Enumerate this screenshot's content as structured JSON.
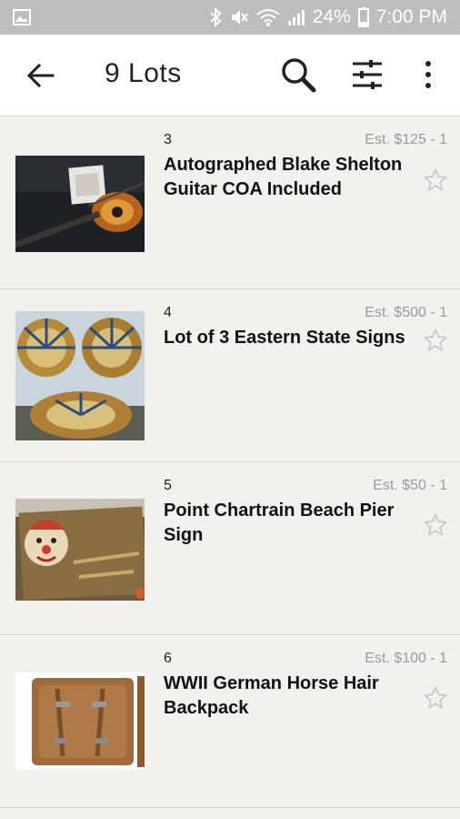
{
  "status_bar": {
    "battery_percent": "24%",
    "time": "7:00 PM",
    "icons": [
      "image-icon",
      "bluetooth-icon",
      "mute-icon",
      "wifi-icon",
      "signal-icon",
      "battery-icon"
    ]
  },
  "app_bar": {
    "title": "9 Lots",
    "icons": [
      "back-arrow-icon",
      "search-icon",
      "filter-icon",
      "more-vert-icon"
    ]
  },
  "lots": [
    {
      "number": "3",
      "estimate": "Est. $125 - 1",
      "title": "Autographed Blake Shelton Guitar COA Included",
      "favorite": false
    },
    {
      "number": "4",
      "estimate": "Est. $500 - 1",
      "title": "Lot of 3 Eastern State Signs",
      "favorite": false
    },
    {
      "number": "5",
      "estimate": "Est. $50 - 1",
      "title": "Point Chartrain Beach Pier Sign",
      "favorite": false
    },
    {
      "number": "6",
      "estimate": "Est. $100 - 1",
      "title": "WWII German Horse Hair Backpack",
      "favorite": false
    }
  ],
  "colors": {
    "status_bar": "#bdbdbd",
    "app_bar": "#ffffff",
    "background": "#f2f1ee",
    "estimate_text": "#9a9a9a"
  }
}
